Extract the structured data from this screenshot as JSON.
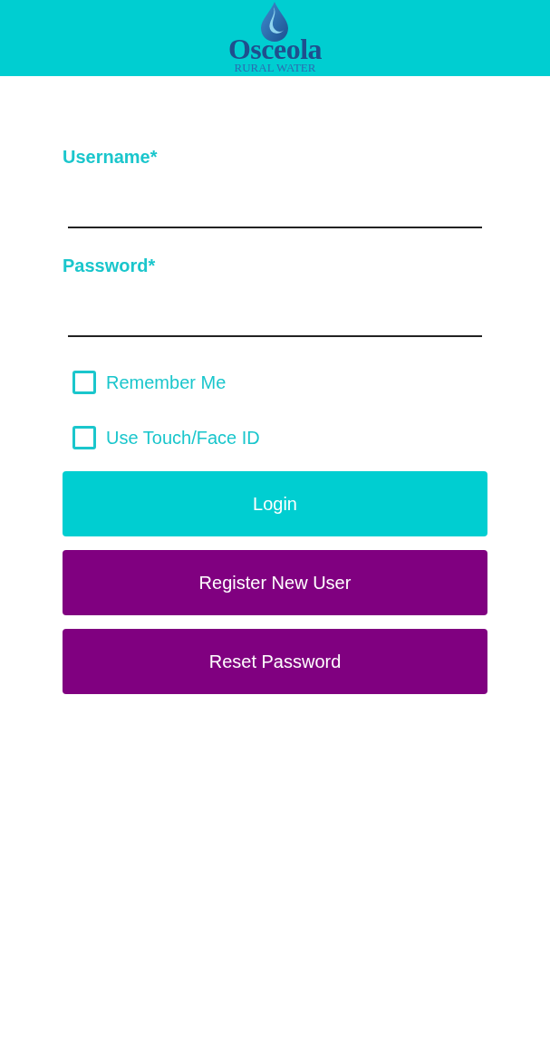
{
  "header": {
    "logo": {
      "name": "Osceola",
      "subtitle": "RURAL WATER"
    }
  },
  "fields": [
    {
      "label": "Username*"
    },
    {
      "label": "Password*"
    }
  ],
  "options": [
    {
      "label": "Remember Me",
      "checked": false
    },
    {
      "label": "Use Touch/Face ID",
      "checked": false
    }
  ],
  "buttons": [
    {
      "label": "Login",
      "color": "#00ced1"
    },
    {
      "label": "Register New User",
      "color": "#800080"
    },
    {
      "label": "Reset Password",
      "color": "#800080"
    }
  ]
}
